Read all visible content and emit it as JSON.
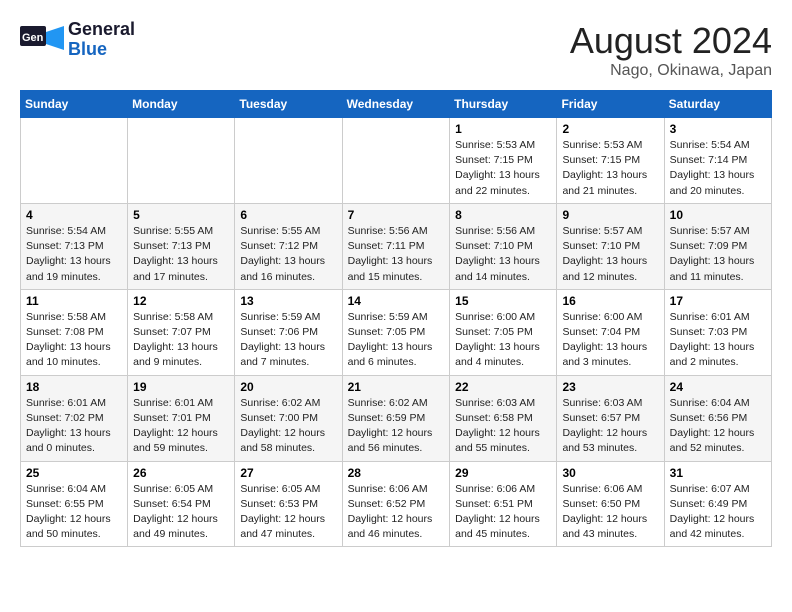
{
  "header": {
    "logo_general": "General",
    "logo_blue": "Blue",
    "month": "August 2024",
    "location": "Nago, Okinawa, Japan"
  },
  "days_of_week": [
    "Sunday",
    "Monday",
    "Tuesday",
    "Wednesday",
    "Thursday",
    "Friday",
    "Saturday"
  ],
  "weeks": [
    [
      {
        "day": "",
        "info": ""
      },
      {
        "day": "",
        "info": ""
      },
      {
        "day": "",
        "info": ""
      },
      {
        "day": "",
        "info": ""
      },
      {
        "day": "1",
        "info": "Sunrise: 5:53 AM\nSunset: 7:15 PM\nDaylight: 13 hours\nand 22 minutes."
      },
      {
        "day": "2",
        "info": "Sunrise: 5:53 AM\nSunset: 7:15 PM\nDaylight: 13 hours\nand 21 minutes."
      },
      {
        "day": "3",
        "info": "Sunrise: 5:54 AM\nSunset: 7:14 PM\nDaylight: 13 hours\nand 20 minutes."
      }
    ],
    [
      {
        "day": "4",
        "info": "Sunrise: 5:54 AM\nSunset: 7:13 PM\nDaylight: 13 hours\nand 19 minutes."
      },
      {
        "day": "5",
        "info": "Sunrise: 5:55 AM\nSunset: 7:13 PM\nDaylight: 13 hours\nand 17 minutes."
      },
      {
        "day": "6",
        "info": "Sunrise: 5:55 AM\nSunset: 7:12 PM\nDaylight: 13 hours\nand 16 minutes."
      },
      {
        "day": "7",
        "info": "Sunrise: 5:56 AM\nSunset: 7:11 PM\nDaylight: 13 hours\nand 15 minutes."
      },
      {
        "day": "8",
        "info": "Sunrise: 5:56 AM\nSunset: 7:10 PM\nDaylight: 13 hours\nand 14 minutes."
      },
      {
        "day": "9",
        "info": "Sunrise: 5:57 AM\nSunset: 7:10 PM\nDaylight: 13 hours\nand 12 minutes."
      },
      {
        "day": "10",
        "info": "Sunrise: 5:57 AM\nSunset: 7:09 PM\nDaylight: 13 hours\nand 11 minutes."
      }
    ],
    [
      {
        "day": "11",
        "info": "Sunrise: 5:58 AM\nSunset: 7:08 PM\nDaylight: 13 hours\nand 10 minutes."
      },
      {
        "day": "12",
        "info": "Sunrise: 5:58 AM\nSunset: 7:07 PM\nDaylight: 13 hours\nand 9 minutes."
      },
      {
        "day": "13",
        "info": "Sunrise: 5:59 AM\nSunset: 7:06 PM\nDaylight: 13 hours\nand 7 minutes."
      },
      {
        "day": "14",
        "info": "Sunrise: 5:59 AM\nSunset: 7:05 PM\nDaylight: 13 hours\nand 6 minutes."
      },
      {
        "day": "15",
        "info": "Sunrise: 6:00 AM\nSunset: 7:05 PM\nDaylight: 13 hours\nand 4 minutes."
      },
      {
        "day": "16",
        "info": "Sunrise: 6:00 AM\nSunset: 7:04 PM\nDaylight: 13 hours\nand 3 minutes."
      },
      {
        "day": "17",
        "info": "Sunrise: 6:01 AM\nSunset: 7:03 PM\nDaylight: 13 hours\nand 2 minutes."
      }
    ],
    [
      {
        "day": "18",
        "info": "Sunrise: 6:01 AM\nSunset: 7:02 PM\nDaylight: 13 hours\nand 0 minutes."
      },
      {
        "day": "19",
        "info": "Sunrise: 6:01 AM\nSunset: 7:01 PM\nDaylight: 12 hours\nand 59 minutes."
      },
      {
        "day": "20",
        "info": "Sunrise: 6:02 AM\nSunset: 7:00 PM\nDaylight: 12 hours\nand 58 minutes."
      },
      {
        "day": "21",
        "info": "Sunrise: 6:02 AM\nSunset: 6:59 PM\nDaylight: 12 hours\nand 56 minutes."
      },
      {
        "day": "22",
        "info": "Sunrise: 6:03 AM\nSunset: 6:58 PM\nDaylight: 12 hours\nand 55 minutes."
      },
      {
        "day": "23",
        "info": "Sunrise: 6:03 AM\nSunset: 6:57 PM\nDaylight: 12 hours\nand 53 minutes."
      },
      {
        "day": "24",
        "info": "Sunrise: 6:04 AM\nSunset: 6:56 PM\nDaylight: 12 hours\nand 52 minutes."
      }
    ],
    [
      {
        "day": "25",
        "info": "Sunrise: 6:04 AM\nSunset: 6:55 PM\nDaylight: 12 hours\nand 50 minutes."
      },
      {
        "day": "26",
        "info": "Sunrise: 6:05 AM\nSunset: 6:54 PM\nDaylight: 12 hours\nand 49 minutes."
      },
      {
        "day": "27",
        "info": "Sunrise: 6:05 AM\nSunset: 6:53 PM\nDaylight: 12 hours\nand 47 minutes."
      },
      {
        "day": "28",
        "info": "Sunrise: 6:06 AM\nSunset: 6:52 PM\nDaylight: 12 hours\nand 46 minutes."
      },
      {
        "day": "29",
        "info": "Sunrise: 6:06 AM\nSunset: 6:51 PM\nDaylight: 12 hours\nand 45 minutes."
      },
      {
        "day": "30",
        "info": "Sunrise: 6:06 AM\nSunset: 6:50 PM\nDaylight: 12 hours\nand 43 minutes."
      },
      {
        "day": "31",
        "info": "Sunrise: 6:07 AM\nSunset: 6:49 PM\nDaylight: 12 hours\nand 42 minutes."
      }
    ]
  ]
}
